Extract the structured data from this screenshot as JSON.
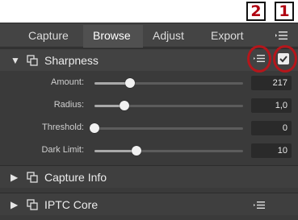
{
  "tabs": [
    "Capture",
    "Browse",
    "Adjust",
    "Export"
  ],
  "active_tab": "Browse",
  "callouts": [
    "2",
    "1"
  ],
  "sharpness": {
    "title": "Sharpness",
    "expanded": true,
    "enabled": true,
    "rows": [
      {
        "label": "Amount:",
        "value": "217",
        "level": 0.24
      },
      {
        "label": "Radius:",
        "value": "1,0",
        "level": 0.2
      },
      {
        "label": "Threshold:",
        "value": "0",
        "level": 0.0
      },
      {
        "label": "Dark Limit:",
        "value": "10",
        "level": 0.28
      }
    ]
  },
  "collapsed_sections": [
    {
      "title": "Capture Info"
    },
    {
      "title": "IPTC Core"
    }
  ],
  "icons": {
    "expand": "triangle-down-icon",
    "collapse": "triangle-right-icon",
    "clone": "clone-icon",
    "presets": "presets-menu-icon",
    "check": "checkmark-icon"
  },
  "colors": {
    "highlight": "#b5161b",
    "callout_text": "#b00010"
  }
}
